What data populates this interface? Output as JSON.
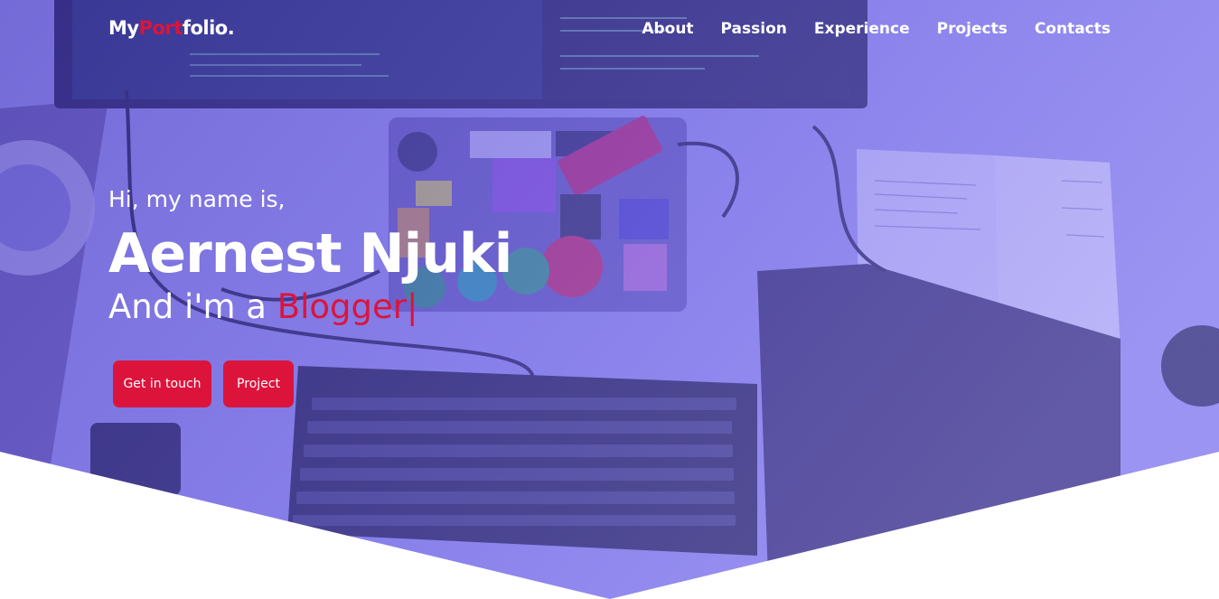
{
  "brand": {
    "prefix": "My",
    "accent": "Port",
    "suffix": "folio."
  },
  "nav": {
    "items": [
      "About",
      "Passion",
      "Experience",
      "Projects",
      "Contacts"
    ]
  },
  "hero": {
    "greeting": "Hi, my name is,",
    "name": "Aernest Njuki",
    "role_prefix": "And i'm a ",
    "role_typed": "Blogger",
    "caret": "|"
  },
  "buttons": {
    "contact": "Get in touch",
    "project": "Project"
  },
  "colors": {
    "accent": "#dc143c",
    "overlay": "#6a5cf0",
    "text": "#ffffff"
  }
}
